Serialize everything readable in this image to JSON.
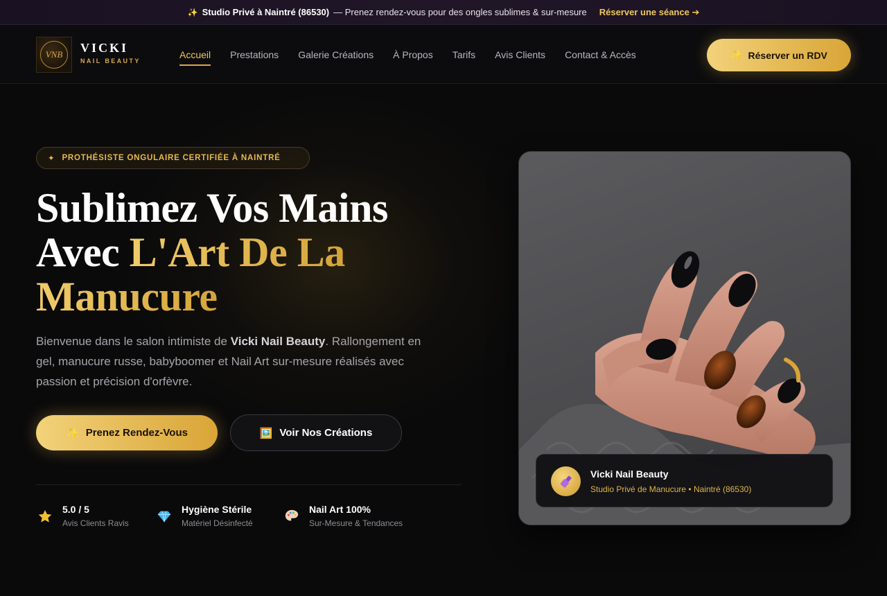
{
  "topbar": {
    "icon": "sparkles-icon",
    "strong": "Studio Privé à Naintré (86530)",
    "text": "— Prenez rendez-vous pour des ongles sublimes & sur-mesure",
    "cta": "Réserver une séance ➔"
  },
  "brand": {
    "monogram": "VNB",
    "name": "VICKI",
    "sub": "NAIL BEAUTY"
  },
  "nav": {
    "items": [
      "Accueil",
      "Prestations",
      "Galerie Créations",
      "À Propos",
      "Tarifs",
      "Avis Clients",
      "Contact & Accès"
    ],
    "active": "Accueil"
  },
  "header_cta": {
    "icon": "sparkles-icon",
    "label": "Réserver un RDV"
  },
  "hero": {
    "badge_icon": "✦",
    "badge": "PROTHÉSISTE ONGULAIRE CERTIFIÉE À NAINTRÉ",
    "title_line1": "Sublimez Vos Mains",
    "title_line2_white": "Avec ",
    "title_line2_gold": "L'Art De La",
    "title_line3_gold": "Manucure",
    "desc_before": "Bienvenue dans le salon intimiste de ",
    "desc_bold": "Vicki Nail Beauty",
    "desc_after": ". Rallongement en gel, manucure russe, babyboomer et Nail Art sur-mesure réalisés avec passion et précision d'orfèvre.",
    "primary_btn": {
      "icon": "sparkles-icon",
      "label": "Prenez Rendez-Vous"
    },
    "secondary_btn": {
      "icon": "picture-icon",
      "label": "Voir Nos Créations"
    }
  },
  "stats": [
    {
      "icon": "star-icon",
      "title": "5.0 / 5",
      "sub": "Avis Clients Ravis"
    },
    {
      "icon": "diamond-icon",
      "title": "Hygiène Stérile",
      "sub": "Matériel Désinfecté"
    },
    {
      "icon": "palette-icon",
      "title": "Nail Art 100%",
      "sub": "Sur-Mesure & Tendances"
    }
  ],
  "photo_card": {
    "icon": "nail-polish-icon",
    "title": "Vicki Nail Beauty",
    "sub": "Studio Privé de Manucure • Naintré (86530)"
  },
  "colors": {
    "gold": "#e0b44a",
    "gold_light": "#f2d27a",
    "bg": "#0a0a0b"
  }
}
